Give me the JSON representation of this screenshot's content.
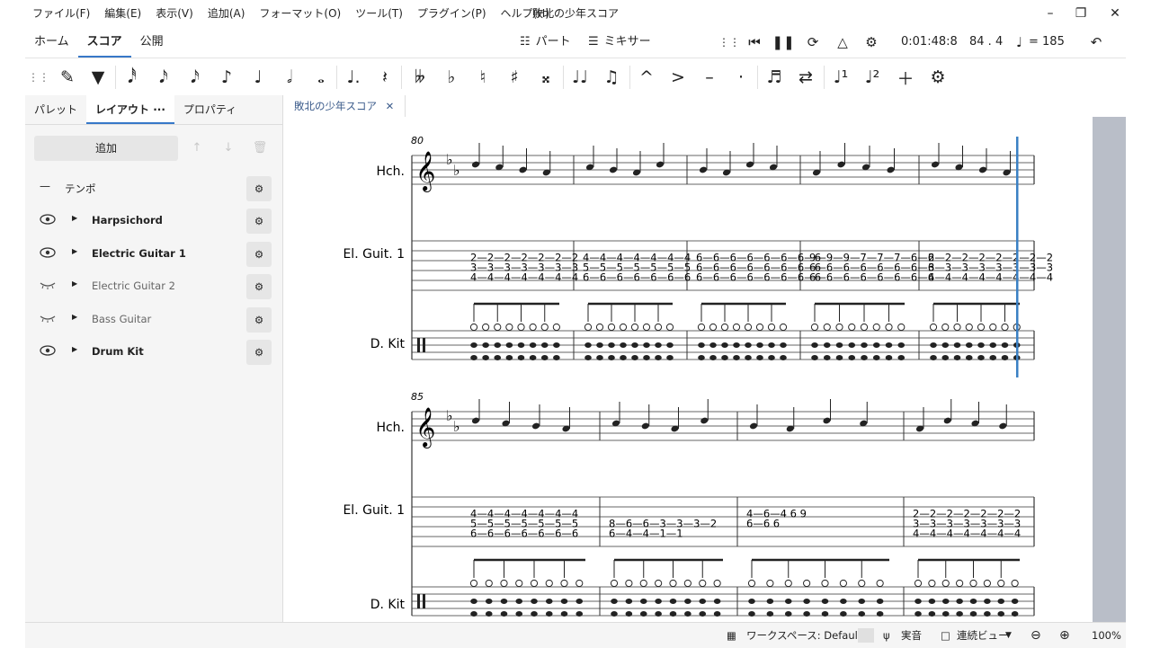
{
  "menu": {
    "items": [
      "ファイル(F)",
      "編集(E)",
      "表示(V)",
      "追加(A)",
      "フォーマット(O)",
      "ツール(T)",
      "プラグイン(P)",
      "ヘルプ(H)"
    ],
    "app_title": "敗北の少年スコア"
  },
  "tabs": {
    "home": "ホーム",
    "score": "スコア",
    "publish": "公開"
  },
  "center": {
    "parts": "パート",
    "mixer": "ミキサー"
  },
  "playback": {
    "time": "0:01:48:8",
    "position": "84 . 4",
    "tempo": "= 185"
  },
  "left_panel": {
    "tabs": {
      "palette": "パレット",
      "layout": "レイアウト",
      "layout_more": "···",
      "properties": "プロパティ"
    },
    "add_label": "追加",
    "tempo_label": "テンポ",
    "instruments": [
      {
        "name": "Harpsichord",
        "visible": true
      },
      {
        "name": "Electric Guitar 1",
        "visible": true
      },
      {
        "name": "Electric Guitar 2",
        "visible": false
      },
      {
        "name": "Bass Guitar",
        "visible": false
      },
      {
        "name": "Drum Kit",
        "visible": true
      }
    ]
  },
  "document": {
    "tab_title": "敗北の少年スコア"
  },
  "score": {
    "system1": {
      "measure_number": "80",
      "labels": {
        "hch": "Hch.",
        "gtr": "El. Guit. 1",
        "drums": "D. Kit"
      },
      "tab_measures": [
        {
          "top": "2—2—2—2—2—2—2",
          "mid": "3—3—3—3—3—3—3",
          "bot": "4—4—4—4—4—4—4"
        },
        {
          "top": "4—4—4—4—4—4—4",
          "mid": "5—5—5—5—5—5—5",
          "bot": "6—6—6—6—6—6—6"
        },
        {
          "top": "6—6—6—6—6—6—6—6",
          "mid": "6—6—6—6—6—6—6—6",
          "bot": "6—6—6—6—6—6—6—6"
        },
        {
          "top": "9—9—9—7—7—7—6—6",
          "mid": "6—6—6—6—6—6—6—6",
          "bot": "6—6—6—6—6—6—6—6"
        },
        {
          "top": "2—2—2—2—2—2—2—2",
          "mid": "3—3—3—3—3—3—3—3",
          "bot": "4—4—4—4—4—4—4—4"
        }
      ]
    },
    "system2": {
      "measure_number": "85",
      "labels": {
        "hch": "Hch.",
        "gtr": "El. Guit. 1",
        "drums": "D. Kit"
      },
      "tab_measures": [
        {
          "top": "4—4—4—4—4—4—4",
          "mid": "5—5—5—5—5—5—5",
          "bot": "6—6—6—6—6—6—6"
        },
        {
          "top": "",
          "mid": "8—6—6—3—3—3—2",
          "bot": "6—4—4—1—1"
        },
        {
          "top": "4—6—4 6 9",
          "mid": "6—6 6",
          "bot": ""
        },
        {
          "top": "2—2—2—2—2—2—2",
          "mid": "3—3—3—3—3—3—3",
          "bot": "4—4—4—4—4—4—4"
        }
      ]
    }
  },
  "status": {
    "workspace": "ワークスペース: Default",
    "concert_pitch": "実音",
    "view_mode": "連続ビュー",
    "zoom": "100%"
  },
  "colors": {
    "accent": "#3778c8",
    "cursor": "#3a80c4",
    "scrollbar": "#b9bec8"
  }
}
